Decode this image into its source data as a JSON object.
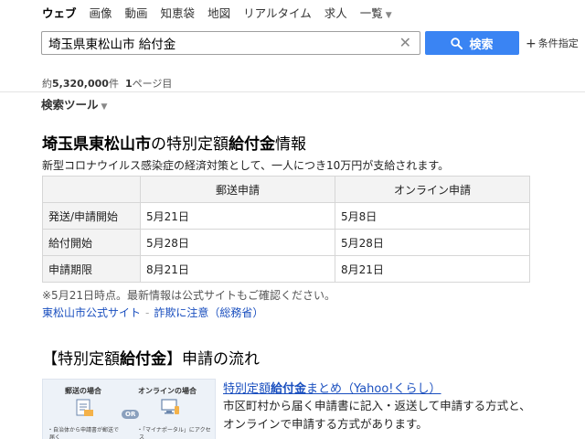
{
  "nav": {
    "tabs": [
      "ウェブ",
      "画像",
      "動画",
      "知恵袋",
      "地図",
      "リアルタイム",
      "求人"
    ],
    "more_label": "一覧"
  },
  "search": {
    "query": "埼玉県東松山市 給付金",
    "button_label": "検索",
    "conditions_label": "条件指定"
  },
  "results_meta": {
    "count_prefix": "約",
    "count": "5,320,000",
    "count_suffix": "件",
    "page": "1",
    "page_suffix": "ページ目"
  },
  "tools_label": "検索ツール",
  "answer": {
    "title_bold": "埼玉県東松山市",
    "title_mid": "の特別定額",
    "title_bold2": "給付金",
    "title_end": "情報",
    "description": "新型コロナウイルス感染症の経済対策として、一人につき10万円が支給されます。",
    "table": {
      "columns": [
        "",
        "郵送申請",
        "オンライン申請"
      ],
      "rows": [
        [
          "発送/申請開始",
          "5月21日",
          "5月8日"
        ],
        [
          "給付開始",
          "5月28日",
          "5月28日"
        ],
        [
          "申請期限",
          "8月21日",
          "8月21日"
        ]
      ]
    },
    "note": "※5月21日時点。最新情報は公式サイトもご確認ください。",
    "links": [
      "東松山市公式サイト",
      "詐欺に注意（総務省）"
    ]
  },
  "flow_section": {
    "title_start": "【特別定額",
    "title_bold": "給付金",
    "title_end": "】申請の流れ",
    "thumbnail": {
      "mail_label": "郵送の場合",
      "online_label": "オンラインの場合",
      "or_label": "OR",
      "mail_note_1": "・自治体から申請書が郵送で",
      "mail_note_2": "届く",
      "online_note_1": "・「マイナポータル」にアクセ",
      "online_note_2": "ス"
    },
    "result_title_start": "特別定額",
    "result_title_bold": "給付金",
    "result_title_end": "まとめ（Yahoo!くらし）",
    "snippet": "市区町村から届く申請書に記入・返送して申請する方式と、オンラインで申請する方式があります。"
  }
}
